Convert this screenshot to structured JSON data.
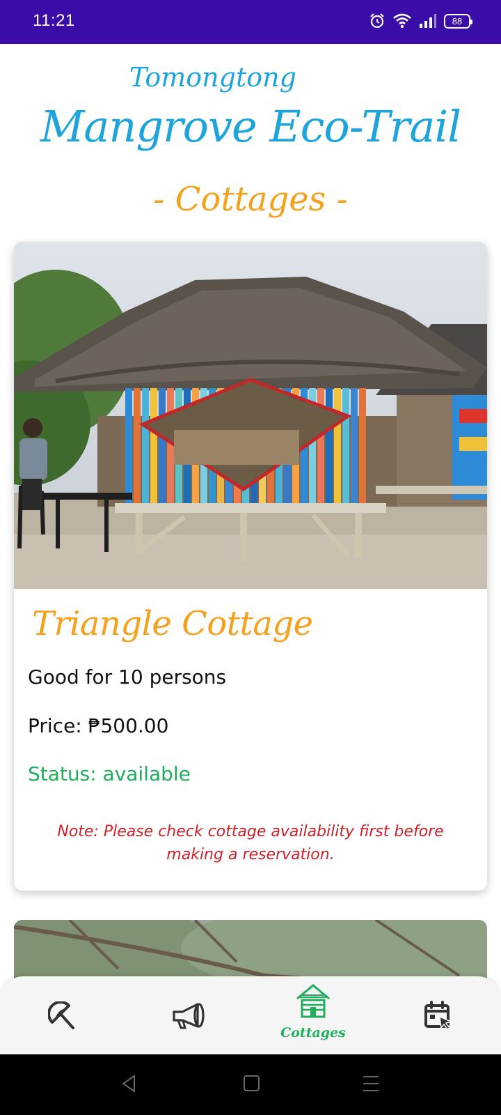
{
  "status_bar": {
    "time": "11:21",
    "battery": "88",
    "icons": [
      "alarm-icon",
      "wifi-icon",
      "signal-icon",
      "battery-icon"
    ]
  },
  "header": {
    "subtitle": "Tomongtong",
    "title": "Mangrove Eco-Trail",
    "section": "- Cottages -"
  },
  "cottage": {
    "name": "Triangle Cottage",
    "capacity": "Good for 10 persons",
    "price": "Price: ₱500.00",
    "status": "Status: available",
    "note": "Note: Please check cottage availability first before making a reservation."
  },
  "bottom_nav": {
    "items": [
      {
        "icon": "beach-umbrella-icon",
        "label": "",
        "active": false
      },
      {
        "icon": "megaphone-icon",
        "label": "",
        "active": false
      },
      {
        "icon": "cottage-icon",
        "label": "Cottages",
        "active": true
      },
      {
        "icon": "calendar-booking-icon",
        "label": "",
        "active": false
      }
    ]
  },
  "system_nav": [
    "back-icon",
    "home-icon",
    "menu-icon"
  ],
  "colors": {
    "status_bar": "#3a0ca8",
    "title_blue": "#1ea4dd",
    "accent_orange": "#f5a11c",
    "status_green": "#1fae5b",
    "note_red": "#d0202a"
  }
}
